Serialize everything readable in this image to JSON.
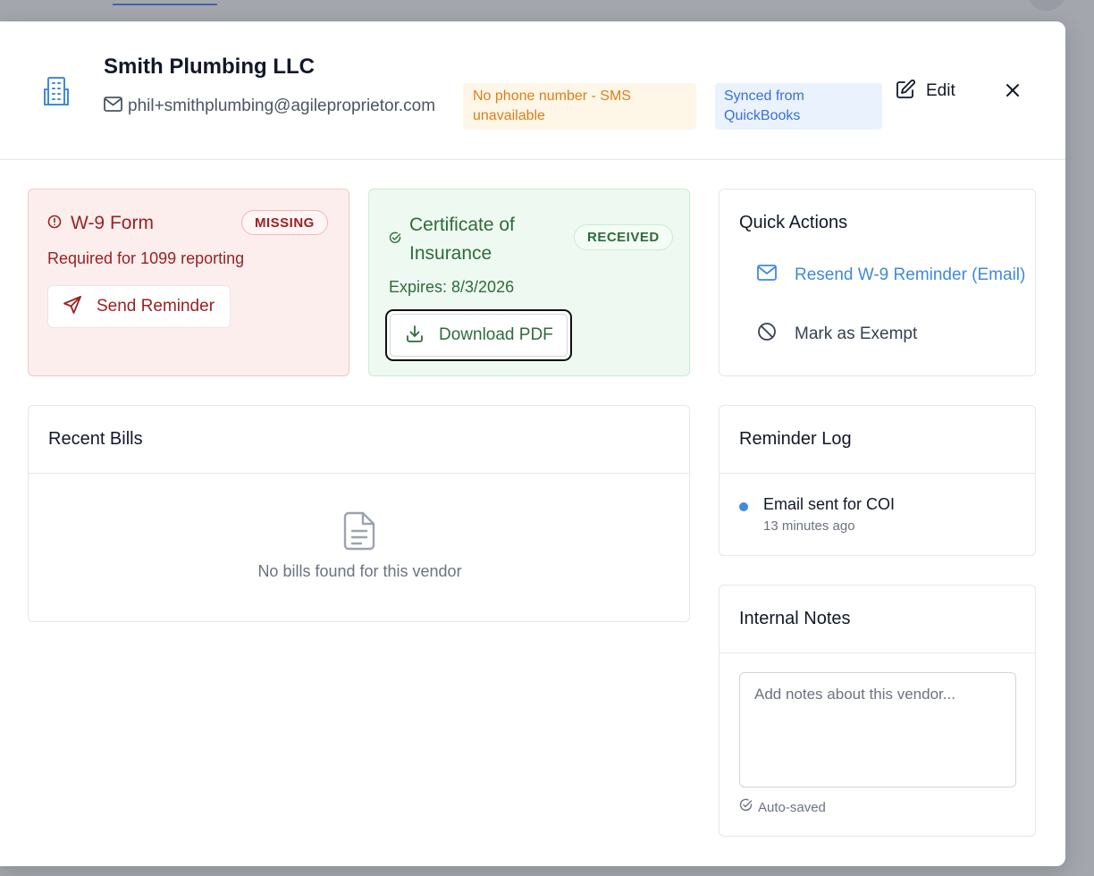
{
  "vendor": {
    "name": "Smith Plumbing LLC",
    "email": "phil+smithplumbing@agileproprietor.com"
  },
  "badges": {
    "sms_warning": "No phone number - SMS unavailable",
    "sync_status": "Synced from QuickBooks"
  },
  "header_actions": {
    "edit_label": "Edit"
  },
  "w9_card": {
    "title": "W-9 Form",
    "status": "MISSING",
    "subtitle": "Required for 1099 reporting",
    "action_label": "Send Reminder"
  },
  "coi_card": {
    "title": "Certificate of Insurance",
    "status": "RECEIVED",
    "expires": "Expires: 8/3/2026",
    "action_label": "Download PDF"
  },
  "quick_actions": {
    "title": "Quick Actions",
    "items": [
      {
        "label": "Resend W-9 Reminder (Email)",
        "icon": "mail-icon"
      },
      {
        "label": "Mark as Exempt",
        "icon": "ban-icon"
      }
    ]
  },
  "recent_bills": {
    "title": "Recent Bills",
    "empty_message": "No bills found for this vendor"
  },
  "reminder_log": {
    "title": "Reminder Log",
    "entries": [
      {
        "text": "Email sent for COI",
        "time": "13 minutes ago"
      }
    ]
  },
  "internal_notes": {
    "title": "Internal Notes",
    "placeholder": "Add notes about this vendor...",
    "value": "",
    "status": "Auto-saved"
  },
  "colors": {
    "accent_blue": "#3f89e0",
    "danger": "#9b2121",
    "success": "#2f6b3b",
    "warning": "#d9801a"
  }
}
